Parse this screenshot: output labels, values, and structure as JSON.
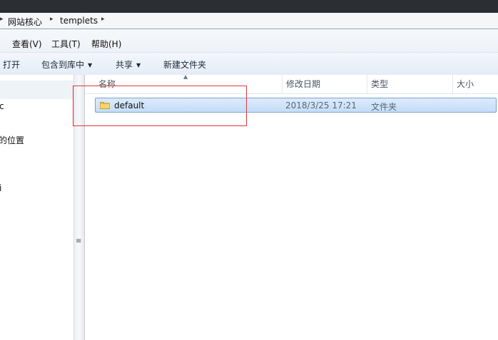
{
  "address": {
    "crumbs": [
      "网站核心",
      "templets"
    ]
  },
  "menu": {
    "items": [
      "查看(V)",
      "工具(T)",
      "帮助(H)"
    ]
  },
  "toolbar": {
    "open": "打开",
    "include_library": "包含到库中",
    "share": "共享",
    "new_folder": "新建文件夹"
  },
  "nav": {
    "labels": [
      "c",
      "的位置",
      "i"
    ]
  },
  "columns": {
    "name": "名称",
    "modified": "修改日期",
    "type": "类型",
    "size": "大小"
  },
  "files": [
    {
      "name": "default",
      "modified": "2018/3/25 17:21",
      "type": "文件夹"
    }
  ],
  "colors": {
    "selection": "#c4ddf8",
    "highlight": "#e0393e",
    "folder": "#e8b83a"
  },
  "icons": {
    "folder": "folder-icon",
    "dropdown": "dropdown-arrow-icon"
  }
}
